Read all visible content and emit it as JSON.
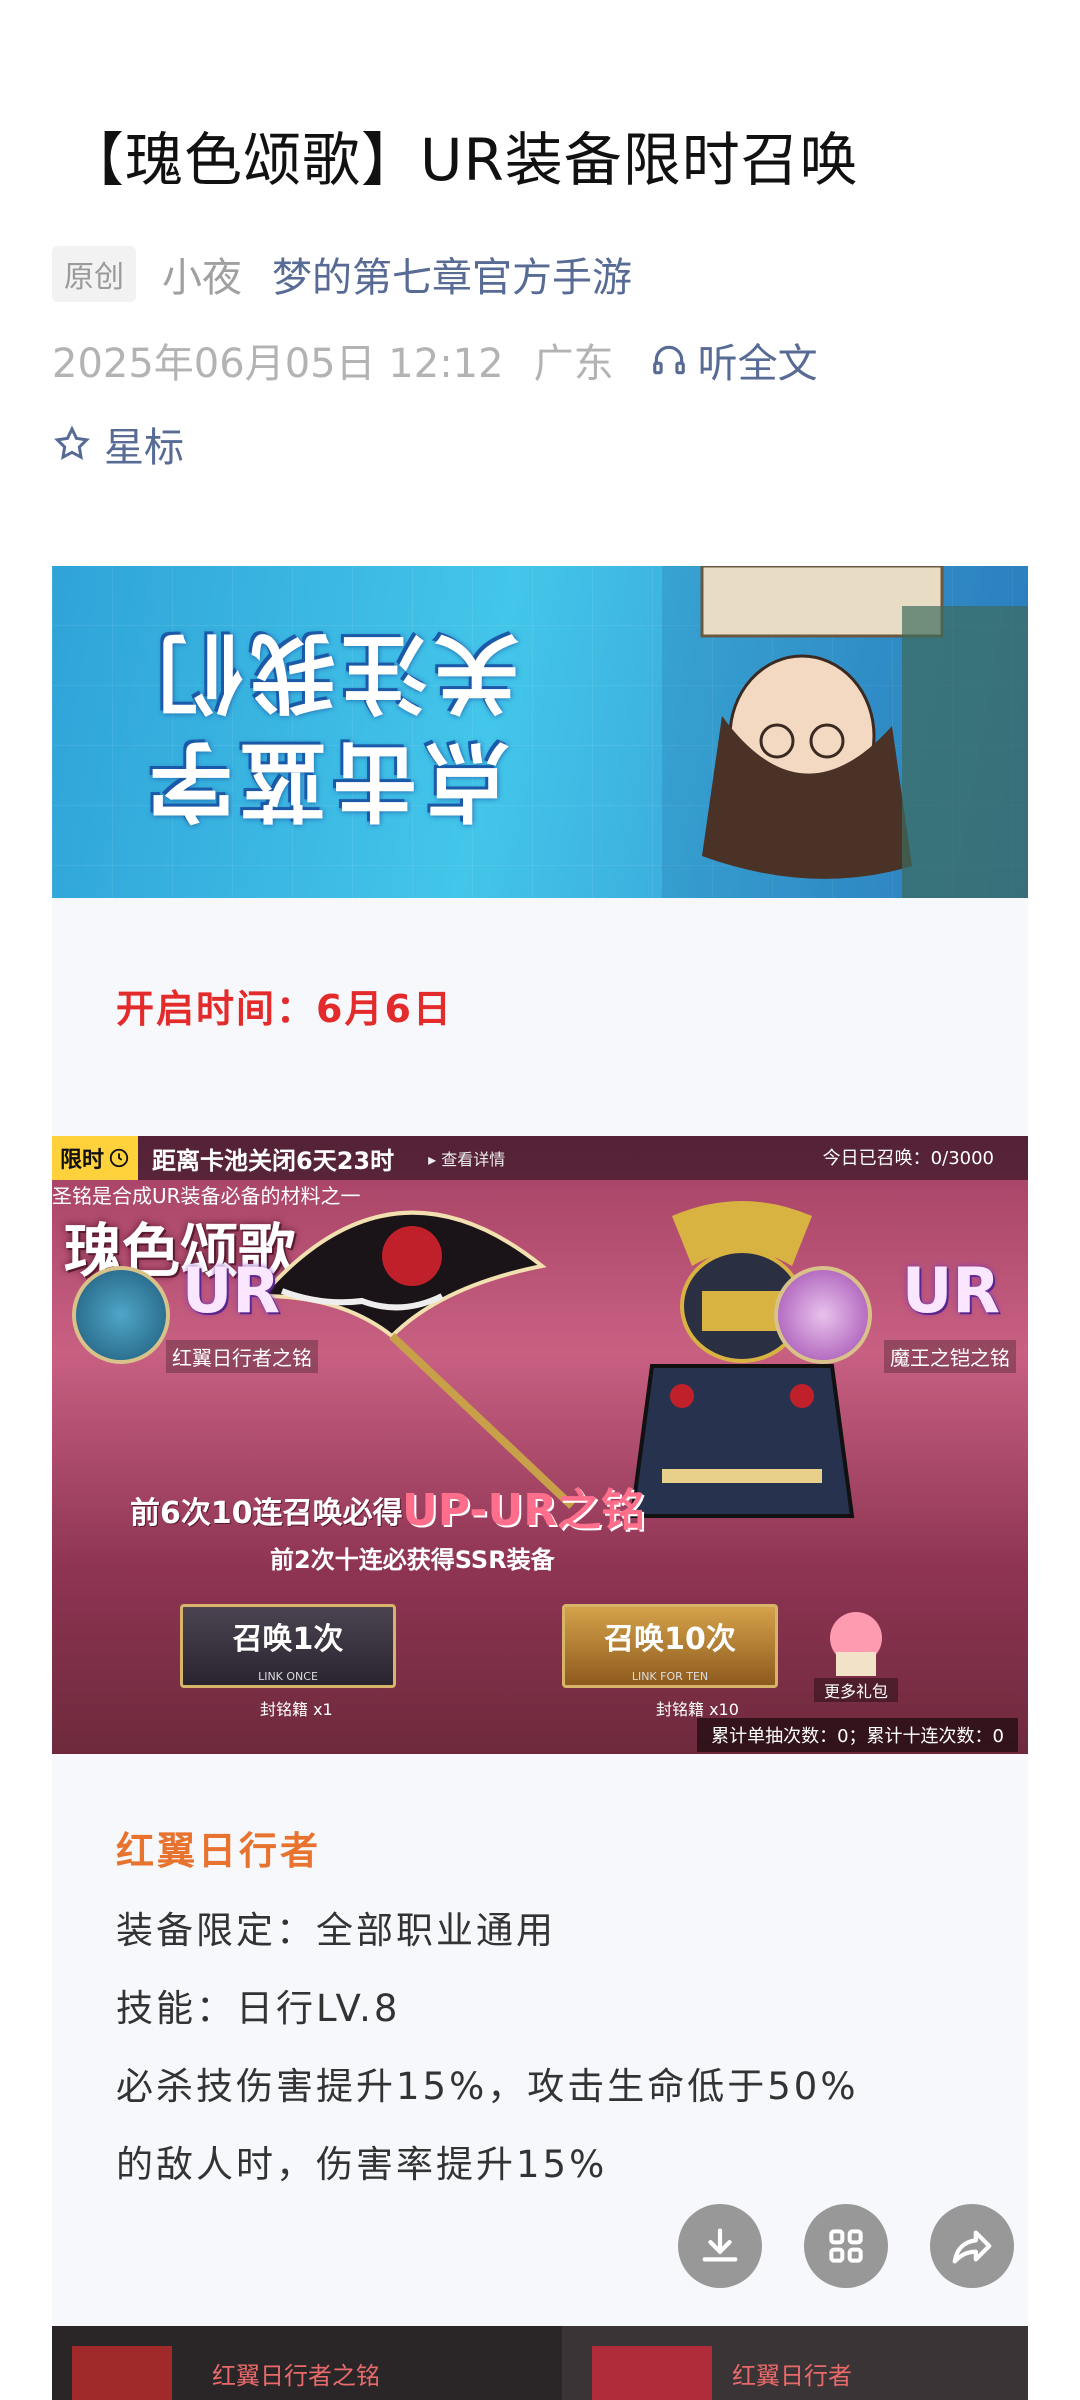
{
  "article": {
    "title": "【瑰色颂歌】UR装备限时召唤",
    "badge": "原创",
    "author": "小夜",
    "account": "梦的第七章官方手游",
    "datetime": "2025年06月05日 12:12",
    "location": "广东",
    "listen_label": "听全文",
    "star_label": "星标"
  },
  "banner": {
    "line1": "关注我们",
    "line2": "点击蓝字"
  },
  "content": {
    "open_time": "开启时间：6月6日",
    "section_title": "红翼日行者",
    "lines": [
      "装备限定：全部职业通用",
      "技能：日行LV.8",
      "必杀技伤害提升15%，攻击生命低于50%",
      "的敌人时，伤害率提升15%"
    ]
  },
  "game": {
    "limit_badge": "限时",
    "countdown": "距离卡池关闭6天23时",
    "detail_link": "▸ 查看详情",
    "today_summons": "今日已召唤：0/3000",
    "tip": "圣铭是合成UR装备必备的材料之一",
    "pool_title": "瑰色颂歌",
    "left_rarity": "UR",
    "left_item": "红翼日行者之铭",
    "right_rarity": "UR",
    "right_item": "魔王之铠之铭",
    "promo_line1": "前6次10连召唤必得",
    "promo_highlight": "UP-UR之铭",
    "promo_line2": "前2次十连必获得SSR装备",
    "btn_single": "召唤1次",
    "btn_single_sub": "LINK ONCE",
    "btn_ten": "召唤10次",
    "btn_ten_sub": "LINK FOR TEN",
    "cost_single": "封铭籍 x1",
    "cost_ten": "封铭籍 x10",
    "more_gifts": "更多礼包",
    "counter": "累计单抽次数：0；累计十连次数：0"
  },
  "bottom_strip": {
    "left_label": "红翼日行者之铭",
    "right_label": "红翼日行者"
  },
  "fabs": [
    "download-icon",
    "grid-icon",
    "share-icon"
  ],
  "colors": {
    "link": "#576b95",
    "open_time": "#e32b2b",
    "section": "#e8732e"
  }
}
